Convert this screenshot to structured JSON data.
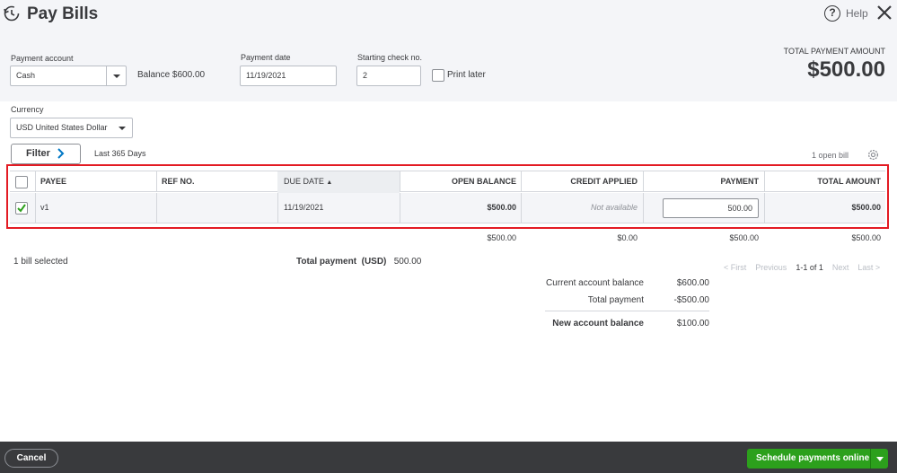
{
  "header": {
    "title": "Pay Bills",
    "help_label": "Help"
  },
  "form": {
    "payment_account_label": "Payment account",
    "payment_account_value": "Cash",
    "balance_label": "Balance",
    "balance_value": "$600.00",
    "payment_date_label": "Payment date",
    "payment_date_value": "11/19/2021",
    "starting_check_label": "Starting check no.",
    "starting_check_value": "2",
    "print_later_label": "Print later",
    "print_later_checked": false,
    "currency_label": "Currency",
    "currency_value": "USD United States Dollar",
    "total_payment_amount_label": "TOTAL PAYMENT AMOUNT",
    "total_payment_amount_value": "$500.00"
  },
  "filter": {
    "label": "Filter",
    "range": "Last 365 Days",
    "open_bill_count": "1 open bill"
  },
  "table": {
    "columns": [
      "PAYEE",
      "REF NO.",
      "DUE DATE",
      "OPEN BALANCE",
      "CREDIT APPLIED",
      "PAYMENT",
      "TOTAL AMOUNT"
    ],
    "sorted_column": "DUE DATE",
    "rows": [
      {
        "checked": true,
        "payee": "v1",
        "ref_no": "",
        "due_date": "11/19/2021",
        "open_balance": "$500.00",
        "credit_applied": "Not available",
        "payment": "500.00",
        "total_amount": "$500.00"
      }
    ],
    "totals": {
      "open_balance": "$500.00",
      "credit_applied": "$0.00",
      "payment": "$500.00",
      "total_amount": "$500.00"
    }
  },
  "summary": {
    "bills_selected": "1 bill selected",
    "total_payment_label": "Total payment",
    "total_payment_currency": "(USD)",
    "total_payment_value": "500.00",
    "pagination": {
      "first": "< First",
      "previous": "Previous",
      "range": "1-1 of 1",
      "next": "Next",
      "last": "Last >"
    },
    "current_account_balance_label": "Current account balance",
    "current_account_balance_value": "$600.00",
    "total_payment_row_label": "Total payment",
    "total_payment_row_value": "-$500.00",
    "new_account_balance_label": "New account balance",
    "new_account_balance_value": "$100.00"
  },
  "footer": {
    "cancel_label": "Cancel",
    "schedule_label": "Schedule payments online"
  },
  "colors": {
    "primary_green": "#2ca01c",
    "highlight_red": "#e31b23",
    "footer_bg": "#393a3d"
  }
}
